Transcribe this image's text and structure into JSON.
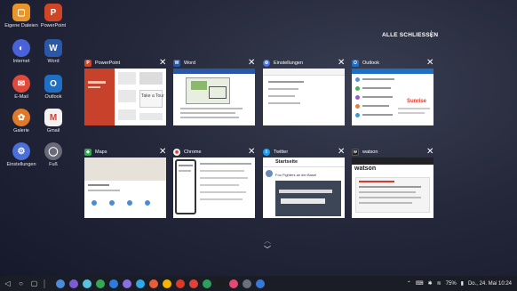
{
  "desktop": [
    {
      "label": "Eigene Dateien",
      "icon": "folder-icon",
      "color": "#e8962b",
      "glyph": "▢"
    },
    {
      "label": "PowerPoint",
      "icon": "powerpoint-icon",
      "color": "#d04525",
      "glyph": "P"
    },
    {
      "label": "Internet",
      "icon": "internet-icon",
      "color": "#4a62d8",
      "glyph": "◐"
    },
    {
      "label": "Word",
      "icon": "word-icon",
      "color": "#2b57a8",
      "glyph": "W"
    },
    {
      "label": "E-Mail",
      "icon": "email-icon",
      "color": "#e04a3c",
      "glyph": "✉"
    },
    {
      "label": "Outlook",
      "icon": "outlook-icon",
      "color": "#1f6fc5",
      "glyph": "O"
    },
    {
      "label": "Galerie",
      "icon": "gallery-icon",
      "color": "#e07a2a",
      "glyph": "✿"
    },
    {
      "label": "Gmail",
      "icon": "gmail-icon",
      "color": "#f2f2f2",
      "glyph": "M"
    },
    {
      "label": "Einstellungen",
      "icon": "settings-icon",
      "color": "#4a6fd8",
      "glyph": "⚙"
    },
    {
      "label": "Fuß",
      "icon": "app-icon",
      "color": "#6a6a7a",
      "glyph": "◯"
    }
  ],
  "header": {
    "close_all": "ALLE SCHLIESSEN",
    "menu_icon": "kebab-menu-icon"
  },
  "cards": [
    {
      "title": "PowerPoint",
      "icon": "powerpoint-icon",
      "icon_color": "#d04525",
      "letter": "P"
    },
    {
      "title": "Word",
      "icon": "word-icon",
      "icon_color": "#2b57a8",
      "letter": "W"
    },
    {
      "title": "Einstellungen",
      "icon": "settings-icon",
      "icon_color": "#4a6fd8",
      "letter": "⚙"
    },
    {
      "title": "Outlook",
      "icon": "outlook-icon",
      "icon_color": "#1f6fc5",
      "letter": "O"
    },
    {
      "title": "Maps",
      "icon": "maps-icon",
      "icon_color": "#34a853",
      "letter": "◆"
    },
    {
      "title": "Chrome",
      "icon": "chrome-icon",
      "icon_color": "#f5f5f5",
      "letter": "◉"
    },
    {
      "title": "Twitter",
      "icon": "twitter-icon",
      "icon_color": "#1da1f2",
      "letter": "t"
    },
    {
      "title": "watson",
      "icon": "watson-icon",
      "icon_color": "#222222",
      "letter": "w"
    }
  ],
  "previews": {
    "powerpoint_text": "Take a Tour",
    "twitter_header": "Startseite",
    "twitter_tweet": "Foo Fighters an der Basel",
    "watson_brand": "watson",
    "outlook_brand": "Sunrise"
  },
  "taskbar": {
    "battery": "75%",
    "datetime": "Do., 24. Mai 10:24",
    "app_colors": [
      "#4b8bd8",
      "#7b5cd6",
      "#59c2e0",
      "#34a853",
      "#2f7be0",
      "#8a6fe0",
      "#2ea8e6",
      "#e85d3a",
      "#f4b400",
      "#d93a2b",
      "#e0413a",
      "#2c9f5a",
      "#1c1c1c",
      "#e24a6f",
      "#6b7080",
      "#3a78d8"
    ]
  }
}
